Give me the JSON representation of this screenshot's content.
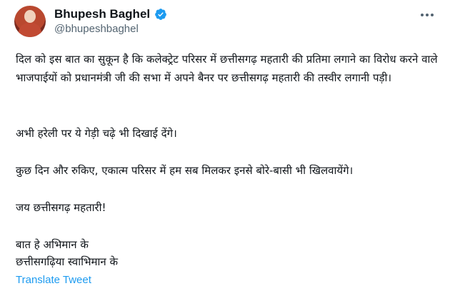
{
  "author": {
    "name": "Bhupesh Baghel",
    "handle": "@bhupeshbaghel"
  },
  "tweet": {
    "paragraph1": "दिल को इस बात का सुकून है कि कलेक्ट्रेट परिसर में छत्तीसगढ़ महतारी की प्रतिमा लगाने का विरोध करने वाले भाजपाईयों को प्रधानमंत्री जी की सभा में अपने बैनर पर छत्तीसगढ़ महतारी की तस्वीर लगानी पड़ी।",
    "paragraph2": "अभी हरेली पर ये गेड़ी चढ़े भी दिखाई देंगे।",
    "paragraph3": "कुछ दिन और रुकिए, एकात्म परिसर में हम सब मिलकर इनसे बोरे-बासी भी खिलवायेंगे।",
    "paragraph4": "जय छत्तीसगढ़ महतारी!",
    "line5a": "बात हे अभिमान के",
    "line5b": "छत्तीसगढ़िया स्वाभिमान के"
  },
  "actions": {
    "translate_label": "Translate Tweet"
  },
  "colors": {
    "verified": "#1d9bf0",
    "link": "#1d9bf0",
    "secondary_text": "#536471"
  }
}
